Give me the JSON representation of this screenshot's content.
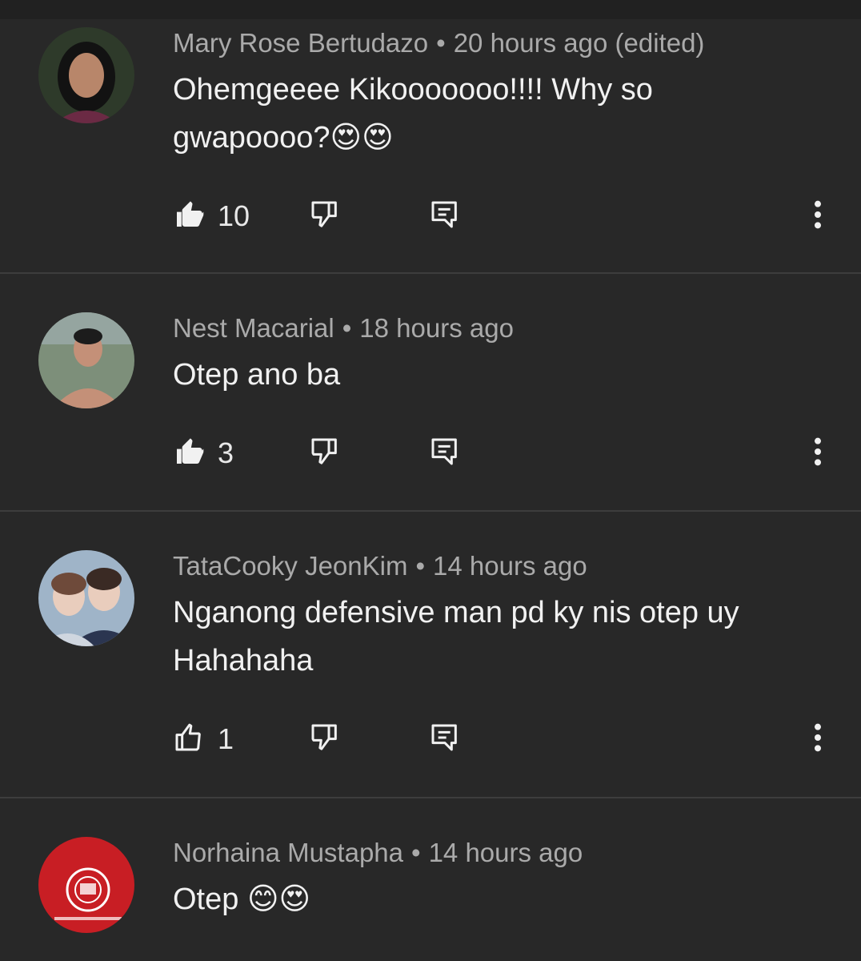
{
  "comments": [
    {
      "author": "Mary Rose Bertudazo",
      "separator": "•",
      "time": "20 hours ago (edited)",
      "text_line1": "Ohemgeeee Kikooooooo!!!! Why so",
      "text_line2": "gwapoooo?😍😍",
      "likes": "10",
      "liked": true,
      "avatar_colors": {
        "bg": "#2e3a2a",
        "skin": "#b8866a",
        "hair": "#121212",
        "shirt": "#6b2a44"
      }
    },
    {
      "author": "Nest Macarial",
      "separator": "•",
      "time": "18 hours ago",
      "text_line1": "Otep ano ba",
      "text_line2": "",
      "likes": "3",
      "liked": true,
      "avatar_colors": {
        "bg": "#7d8f7a",
        "skin": "#c49078",
        "hair": "#1c1c1c",
        "shirt": "#c49078"
      }
    },
    {
      "author": "TataCooky JeonKim",
      "separator": "•",
      "time": "14 hours ago",
      "text_line1": "Nganong defensive man pd ky nis otep uy",
      "text_line2": "Hahahaha",
      "likes": "1",
      "liked": false,
      "avatar_colors": {
        "bg": "#9fb4c8",
        "skin": "#e9cdbd",
        "hair": "#6e4a3a",
        "shirt": "#2b3550"
      }
    },
    {
      "author": "Norhaina Mustapha",
      "separator": "•",
      "time": "14 hours ago",
      "text_line1": "Otep 😊😍",
      "text_line2": "",
      "likes": "",
      "liked": false,
      "avatar_colors": {
        "bg": "#c81e24",
        "skin": "#ffffff",
        "hair": "#ffffff",
        "shirt": "#c81e24"
      }
    }
  ],
  "icons": {
    "like": "thumbs-up-icon",
    "dislike": "thumbs-down-icon",
    "reply": "reply-icon",
    "menu": "more-vertical-icon"
  },
  "colors": {
    "background": "#282828",
    "divider": "#3d3d3d",
    "meta_text": "#aaaaaa",
    "body_text": "#f1f1f1"
  }
}
